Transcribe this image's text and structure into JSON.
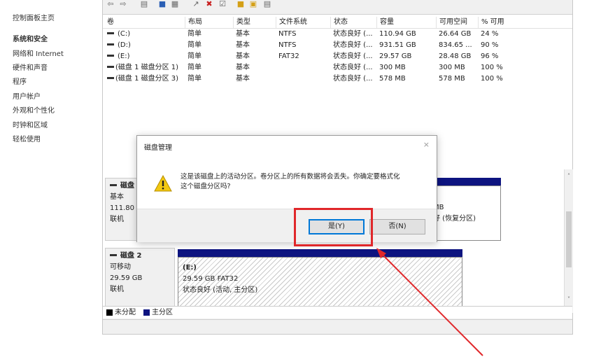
{
  "sidebar": {
    "items": [
      {
        "label": "控制面板主页"
      },
      {
        "label": "系统和安全"
      },
      {
        "label": "网络和 Internet"
      },
      {
        "label": "硬件和声音"
      },
      {
        "label": "程序"
      },
      {
        "label": "用户帐户"
      },
      {
        "label": "外观和个性化"
      },
      {
        "label": "时钟和区域"
      },
      {
        "label": "轻松使用"
      }
    ]
  },
  "toolbar": {
    "icons": [
      "back-icon",
      "forward-icon",
      "properties-icon",
      "help-icon",
      "view-icon",
      "connect-icon",
      "delete-icon",
      "check-icon",
      "folder-icon",
      "open-icon",
      "document-icon"
    ]
  },
  "volume_list": {
    "columns": [
      "卷",
      "布局",
      "类型",
      "文件系统",
      "状态",
      "容量",
      "可用空间",
      "% 可用"
    ],
    "rows": [
      [
        "(C:)",
        "简单",
        "基本",
        "NTFS",
        "状态良好 (...",
        "110.94 GB",
        "26.64 GB",
        "24 %"
      ],
      [
        "(D:)",
        "简单",
        "基本",
        "NTFS",
        "状态良好 (...",
        "931.51 GB",
        "834.65 ...",
        "90 %"
      ],
      [
        "(E:)",
        "简单",
        "基本",
        "FAT32",
        "状态良好 (...",
        "29.57 GB",
        "28.48 GB",
        "96 %"
      ],
      [
        "(磁盘 1 磁盘分区 1)",
        "简单",
        "基本",
        "",
        "状态良好 (...",
        "300 MB",
        "300 MB",
        "100 %"
      ],
      [
        "(磁盘 1 磁盘分区 3)",
        "简单",
        "基本",
        "",
        "状态良好 (...",
        "578 MB",
        "578 MB",
        "100 %"
      ]
    ]
  },
  "disks": {
    "disk1": {
      "name": "磁盘",
      "type": "基本",
      "size": "111.80 G",
      "status": "联机",
      "partition_size": "MB",
      "partition_status": "好 (恢复分区)"
    },
    "disk2": {
      "name": "磁盘 2",
      "type": "可移动",
      "size": "29.59 GB",
      "status": "联机",
      "partition_name": "(E:)",
      "partition_size": "29.59 GB FAT32",
      "partition_status": "状态良好 (活动, 主分区)"
    }
  },
  "legend": {
    "unallocated": "未分配",
    "primary": "主分区"
  },
  "dialog": {
    "title": "磁盘管理",
    "close": "×",
    "message_line1": "这是该磁盘上的活动分区。卷分区上的所有数据将会丢失。你确定要格式化",
    "message_line2": "这个磁盘分区吗?",
    "yes_label": "是(Y)",
    "no_label": "否(N)"
  },
  "colors": {
    "primary_partition": "#0d1480",
    "unallocated": "#000000",
    "annotation": "#e0272a"
  }
}
